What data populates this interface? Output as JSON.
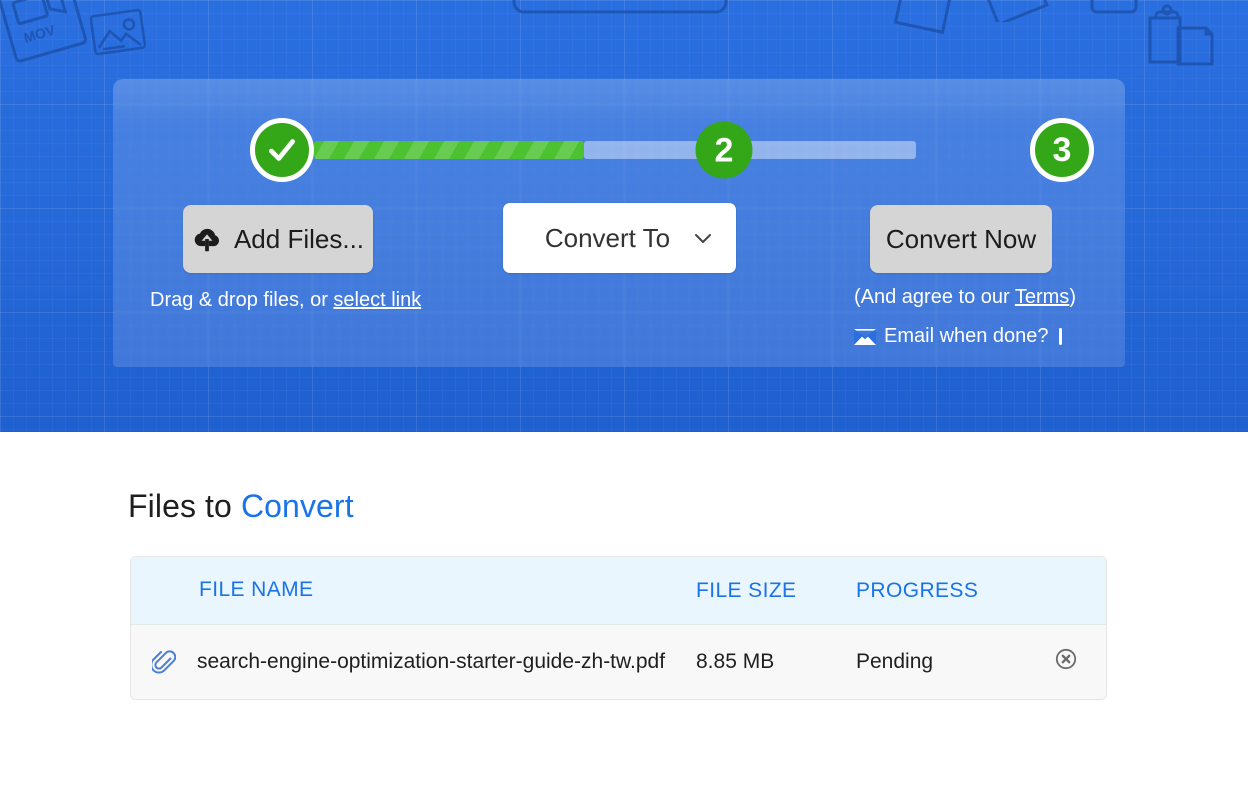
{
  "hero": {
    "stepper": {
      "step1_state": "complete",
      "step1_icon": "check-icon",
      "step2_label": "2",
      "step3_label": "3",
      "progress_done_color": "#4cc231",
      "progress_todo_color": "#b9cdf0",
      "node_color": "#34a718"
    },
    "add_files_button": "Add Files...",
    "add_files_icon": "cloud-upload-icon",
    "convert_to_select": {
      "value": "Convert To",
      "chevron_icon": "chevron-down-icon"
    },
    "convert_now_button": "Convert Now",
    "drag_hint_prefix": "Drag & drop files, or ",
    "drag_hint_link": "select link",
    "terms_prefix": "(And agree to our ",
    "terms_link": "Terms",
    "terms_suffix": ")",
    "email_icon": "envelope-icon",
    "email_label": "Email when done?",
    "email_checked": false
  },
  "files": {
    "title_prefix": "Files to ",
    "title_accent": "Convert",
    "accent_color": "#1a73e8",
    "columns": {
      "file_name": "FILE NAME",
      "file_size": "FILE SIZE",
      "progress": "PROGRESS"
    },
    "rows": [
      {
        "clip_icon": "paperclip-icon",
        "name": "search-engine-optimization-starter-guide-zh-tw.pdf",
        "size": "8.85 MB",
        "progress": "Pending",
        "remove_icon": "remove-circle-icon"
      }
    ]
  }
}
